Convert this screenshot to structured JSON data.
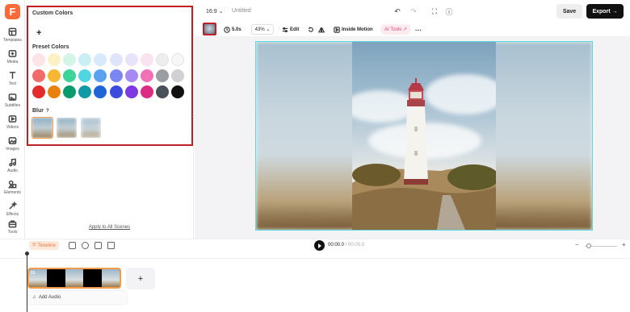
{
  "brand": {
    "logo_letter": "F",
    "accent": "#fb6b3a"
  },
  "sidebar": {
    "items": [
      {
        "label": "Templates",
        "icon": "templates-icon"
      },
      {
        "label": "Media",
        "icon": "media-icon"
      },
      {
        "label": "Text",
        "icon": "text-icon"
      },
      {
        "label": "Subtitles",
        "icon": "subtitles-icon"
      },
      {
        "label": "Videos",
        "icon": "videos-icon"
      },
      {
        "label": "Images",
        "icon": "images-icon"
      },
      {
        "label": "Audio",
        "icon": "audio-icon"
      },
      {
        "label": "Elements",
        "icon": "elements-icon"
      },
      {
        "label": "Effects",
        "icon": "effects-icon"
      },
      {
        "label": "Tools",
        "icon": "tools-icon"
      }
    ]
  },
  "panel": {
    "custom_colors_label": "Custom Colors",
    "add_symbol": "+",
    "preset_colors_label": "Preset Colors",
    "preset_colors": [
      [
        "#fbe3e6",
        "#fbf1c4",
        "#d4f4e7",
        "#c9eff4",
        "#d7e9fb",
        "#dfe4fb",
        "#e8e2fb",
        "#f9e1ef",
        "#ededed",
        "#f7f7f7"
      ],
      [
        "#f26b6b",
        "#f7b733",
        "#3dd39a",
        "#4fd6e0",
        "#5aa2ef",
        "#7b86f2",
        "#a58af4",
        "#f271b6",
        "#9b9fa3",
        "#cfd1d3"
      ],
      [
        "#e22b2b",
        "#e8820c",
        "#089b6e",
        "#0f9aa6",
        "#1f63d6",
        "#3b4bde",
        "#7d3ae3",
        "#dd2a85",
        "#4a5057",
        "#111111"
      ]
    ],
    "blur_label": "Blur",
    "blur_help": "?",
    "apply_all": "Apply to All Scenes"
  },
  "header": {
    "aspect_ratio": "16:9",
    "title": "Untitled",
    "save_label": "Save",
    "export_label": "Export"
  },
  "toolbar": {
    "duration": "5.0s",
    "zoom": "43%",
    "edit_label": "Edit",
    "inside_motion_label": "Inside Motion",
    "ai_tools_label": "AI Tools",
    "more": "···"
  },
  "timeline": {
    "label": "Timeline",
    "current_time": "00:00.0",
    "total_time": "/ 00:05.0",
    "clip_number": "01",
    "add_clip": "+",
    "add_audio": "Add Audio",
    "zoom_out": "−",
    "zoom_in": "+"
  }
}
